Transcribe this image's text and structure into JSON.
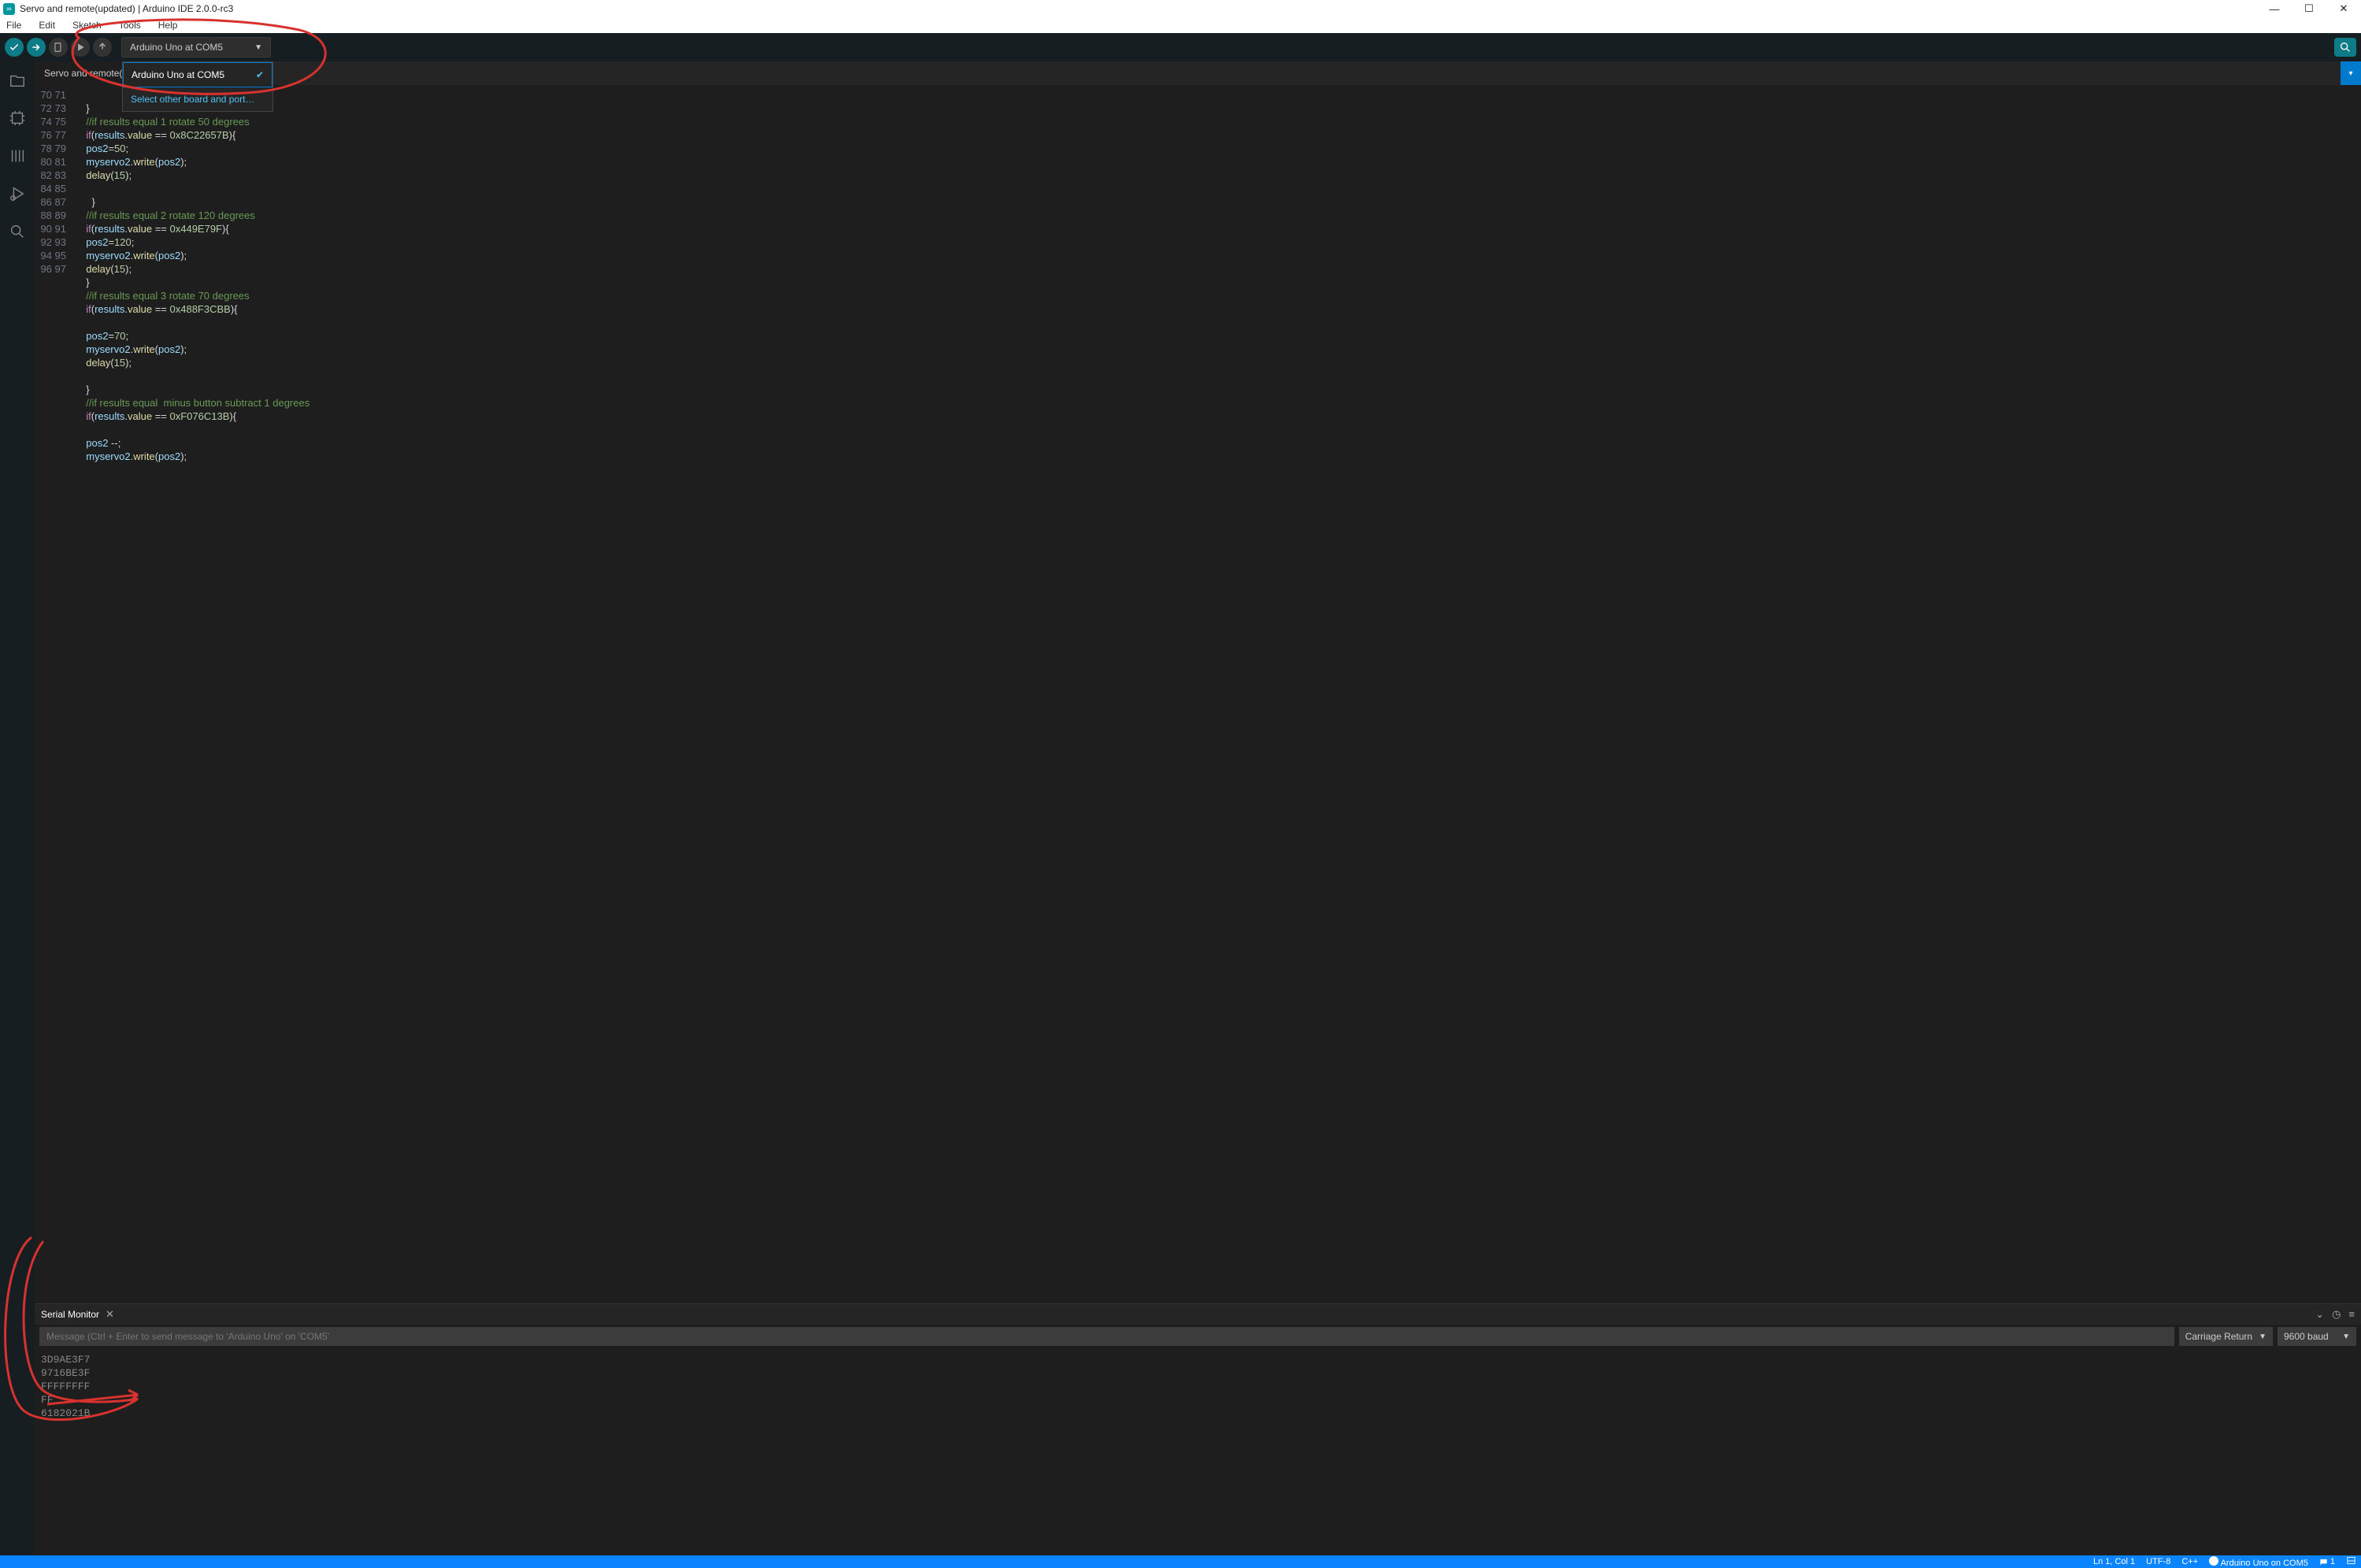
{
  "window": {
    "title": "Servo and remote(updated) | Arduino IDE 2.0.0-rc3"
  },
  "menu": {
    "file": "File",
    "edit": "Edit",
    "sketch": "Sketch",
    "tools": "Tools",
    "help": "Help"
  },
  "board": {
    "selected": "Arduino Uno at COM5",
    "opt_selected": "Arduino Uno at COM5",
    "opt_other": "Select other board and port…"
  },
  "tabs": {
    "main": "Servo and remote(updated).ino"
  },
  "code": {
    "first_line": 70,
    "lines": [
      {
        "n": 70,
        "seg": [
          {
            "c": "p",
            "t": "  "
          }
        ]
      },
      {
        "n": 71,
        "seg": [
          {
            "c": "p",
            "t": "  }"
          }
        ]
      },
      {
        "n": 72,
        "seg": [
          {
            "c": "c",
            "t": "  //if results equal 1 rotate 50 degrees"
          }
        ]
      },
      {
        "n": 73,
        "seg": [
          {
            "c": "p",
            "t": "  "
          },
          {
            "c": "k",
            "t": "if"
          },
          {
            "c": "p",
            "t": "("
          },
          {
            "c": "v",
            "t": "results"
          },
          {
            "c": "p",
            "t": "."
          },
          {
            "c": "f",
            "t": "value"
          },
          {
            "c": "o",
            "t": " == "
          },
          {
            "c": "n",
            "t": "0x8C22657B"
          },
          {
            "c": "p",
            "t": "){"
          }
        ]
      },
      {
        "n": 74,
        "seg": [
          {
            "c": "p",
            "t": "  "
          },
          {
            "c": "v",
            "t": "pos2"
          },
          {
            "c": "o",
            "t": "="
          },
          {
            "c": "n",
            "t": "50"
          },
          {
            "c": "p",
            "t": ";"
          }
        ]
      },
      {
        "n": 75,
        "seg": [
          {
            "c": "p",
            "t": "  "
          },
          {
            "c": "v",
            "t": "myservo2"
          },
          {
            "c": "p",
            "t": "."
          },
          {
            "c": "f",
            "t": "write"
          },
          {
            "c": "p",
            "t": "("
          },
          {
            "c": "v",
            "t": "pos2"
          },
          {
            "c": "p",
            "t": ");"
          }
        ]
      },
      {
        "n": 76,
        "seg": [
          {
            "c": "p",
            "t": "  "
          },
          {
            "c": "f",
            "t": "delay"
          },
          {
            "c": "p",
            "t": "("
          },
          {
            "c": "n",
            "t": "15"
          },
          {
            "c": "p",
            "t": ");"
          }
        ]
      },
      {
        "n": 77,
        "seg": [
          {
            "c": "p",
            "t": ""
          }
        ]
      },
      {
        "n": 78,
        "seg": [
          {
            "c": "p",
            "t": "    }"
          }
        ]
      },
      {
        "n": 79,
        "seg": [
          {
            "c": "c",
            "t": "  //if results equal 2 rotate 120 degrees"
          }
        ]
      },
      {
        "n": 80,
        "seg": [
          {
            "c": "p",
            "t": "  "
          },
          {
            "c": "k",
            "t": "if"
          },
          {
            "c": "p",
            "t": "("
          },
          {
            "c": "v",
            "t": "results"
          },
          {
            "c": "p",
            "t": "."
          },
          {
            "c": "f",
            "t": "value"
          },
          {
            "c": "o",
            "t": " == "
          },
          {
            "c": "n",
            "t": "0x449E79F"
          },
          {
            "c": "p",
            "t": "){"
          }
        ]
      },
      {
        "n": 81,
        "seg": [
          {
            "c": "p",
            "t": "  "
          },
          {
            "c": "v",
            "t": "pos2"
          },
          {
            "c": "o",
            "t": "="
          },
          {
            "c": "n",
            "t": "120"
          },
          {
            "c": "p",
            "t": ";"
          }
        ]
      },
      {
        "n": 82,
        "seg": [
          {
            "c": "p",
            "t": "  "
          },
          {
            "c": "v",
            "t": "myservo2"
          },
          {
            "c": "p",
            "t": "."
          },
          {
            "c": "f",
            "t": "write"
          },
          {
            "c": "p",
            "t": "("
          },
          {
            "c": "v",
            "t": "pos2"
          },
          {
            "c": "p",
            "t": ");"
          }
        ]
      },
      {
        "n": 83,
        "seg": [
          {
            "c": "p",
            "t": "  "
          },
          {
            "c": "f",
            "t": "delay"
          },
          {
            "c": "p",
            "t": "("
          },
          {
            "c": "n",
            "t": "15"
          },
          {
            "c": "p",
            "t": ");"
          }
        ]
      },
      {
        "n": 84,
        "seg": [
          {
            "c": "p",
            "t": "  }"
          }
        ]
      },
      {
        "n": 85,
        "seg": [
          {
            "c": "c",
            "t": "  //if results equal 3 rotate 70 degrees"
          }
        ]
      },
      {
        "n": 86,
        "seg": [
          {
            "c": "p",
            "t": "  "
          },
          {
            "c": "k",
            "t": "if"
          },
          {
            "c": "p",
            "t": "("
          },
          {
            "c": "v",
            "t": "results"
          },
          {
            "c": "p",
            "t": "."
          },
          {
            "c": "f",
            "t": "value"
          },
          {
            "c": "o",
            "t": " == "
          },
          {
            "c": "n",
            "t": "0x488F3CBB"
          },
          {
            "c": "p",
            "t": "){"
          }
        ]
      },
      {
        "n": 87,
        "seg": [
          {
            "c": "p",
            "t": ""
          }
        ]
      },
      {
        "n": 88,
        "seg": [
          {
            "c": "p",
            "t": "  "
          },
          {
            "c": "v",
            "t": "pos2"
          },
          {
            "c": "o",
            "t": "="
          },
          {
            "c": "n",
            "t": "70"
          },
          {
            "c": "p",
            "t": ";"
          }
        ]
      },
      {
        "n": 89,
        "seg": [
          {
            "c": "p",
            "t": "  "
          },
          {
            "c": "v",
            "t": "myservo2"
          },
          {
            "c": "p",
            "t": "."
          },
          {
            "c": "f",
            "t": "write"
          },
          {
            "c": "p",
            "t": "("
          },
          {
            "c": "v",
            "t": "pos2"
          },
          {
            "c": "p",
            "t": ");"
          }
        ]
      },
      {
        "n": 90,
        "seg": [
          {
            "c": "p",
            "t": "  "
          },
          {
            "c": "f",
            "t": "delay"
          },
          {
            "c": "p",
            "t": "("
          },
          {
            "c": "n",
            "t": "15"
          },
          {
            "c": "p",
            "t": ");"
          }
        ]
      },
      {
        "n": 91,
        "seg": [
          {
            "c": "p",
            "t": ""
          }
        ]
      },
      {
        "n": 92,
        "seg": [
          {
            "c": "p",
            "t": "  }"
          }
        ]
      },
      {
        "n": 93,
        "seg": [
          {
            "c": "c",
            "t": "  //if results equal  minus button subtract 1 degrees"
          }
        ]
      },
      {
        "n": 94,
        "seg": [
          {
            "c": "p",
            "t": "  "
          },
          {
            "c": "k",
            "t": "if"
          },
          {
            "c": "p",
            "t": "("
          },
          {
            "c": "v",
            "t": "results"
          },
          {
            "c": "p",
            "t": "."
          },
          {
            "c": "f",
            "t": "value"
          },
          {
            "c": "o",
            "t": " == "
          },
          {
            "c": "n",
            "t": "0xF076C13B"
          },
          {
            "c": "p",
            "t": "){"
          }
        ]
      },
      {
        "n": 95,
        "seg": [
          {
            "c": "p",
            "t": ""
          }
        ]
      },
      {
        "n": 96,
        "seg": [
          {
            "c": "p",
            "t": "  "
          },
          {
            "c": "v",
            "t": "pos2"
          },
          {
            "c": "o",
            "t": " --;"
          }
        ]
      },
      {
        "n": 97,
        "seg": [
          {
            "c": "p",
            "t": "  "
          },
          {
            "c": "v",
            "t": "myservo2"
          },
          {
            "c": "p",
            "t": "."
          },
          {
            "c": "f",
            "t": "write"
          },
          {
            "c": "p",
            "t": "("
          },
          {
            "c": "v",
            "t": "pos2"
          },
          {
            "c": "p",
            "t": ");"
          }
        ]
      }
    ]
  },
  "monitor": {
    "tab": "Serial Monitor",
    "input_placeholder": "Message (Ctrl + Enter to send message to 'Arduino Uno' on 'COM5'",
    "line_ending": "Carriage Return",
    "baud": "9600 baud",
    "output": [
      "3D9AE3F7",
      "9716BE3F",
      "FFFFFFFF",
      "FF",
      "6182021B"
    ]
  },
  "status": {
    "pos": "Ln 1, Col 1",
    "enc": "UTF-8",
    "lang": "C++",
    "board": "Arduino Uno on COM5",
    "notif": "1"
  }
}
